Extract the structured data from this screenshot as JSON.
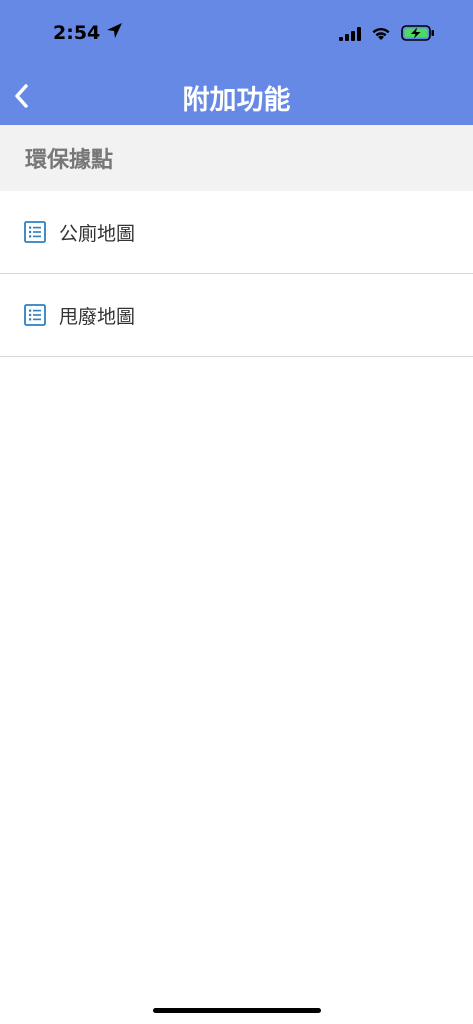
{
  "status_bar": {
    "time": "2:54"
  },
  "nav": {
    "title": "附加功能"
  },
  "section": {
    "title": "環保據點"
  },
  "items": [
    {
      "label": "公廁地圖"
    },
    {
      "label": "甩廢地圖"
    }
  ],
  "colors": {
    "accent": "#6589e5",
    "icon": "#2e7fc1",
    "section_bg": "#f2f2f2"
  }
}
